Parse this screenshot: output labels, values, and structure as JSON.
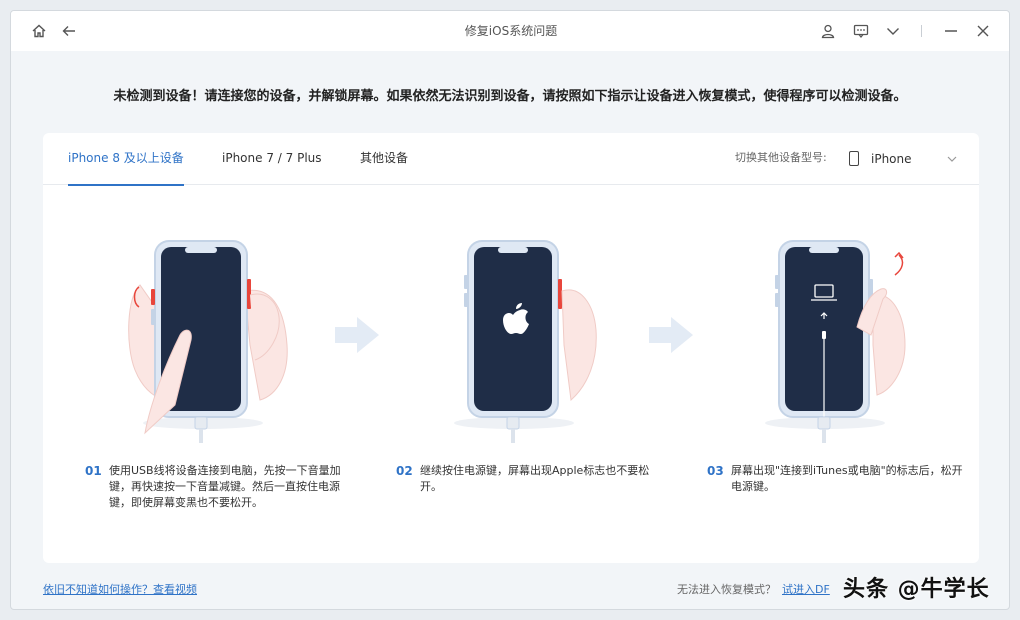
{
  "window": {
    "title": "修复iOS系统问题"
  },
  "notice": "未检测到设备！请连接您的设备，并解锁屏幕。如果依然无法识别到设备，请按照如下指示让设备进入恢复模式，使得程序可以检测设备。",
  "tabs": [
    {
      "label": "iPhone 8 及以上设备",
      "active": true
    },
    {
      "label": "iPhone 7 / 7 Plus",
      "active": false
    },
    {
      "label": "其他设备",
      "active": false
    }
  ],
  "device_switch": {
    "label": "切换其他设备型号:",
    "selected": "iPhone"
  },
  "steps": [
    {
      "num": "01",
      "desc": "使用USB线将设备连接到电脑，先按一下音量加键，再快速按一下音量减键。然后一直按住电源键，即使屏幕变黑也不要松开。"
    },
    {
      "num": "02",
      "desc": "继续按住电源键，屏幕出现Apple标志也不要松开。"
    },
    {
      "num": "03",
      "desc": "屏幕出现\"连接到iTunes或电脑\"的标志后，松开电源键。"
    }
  ],
  "footer": {
    "help_link": "依旧不知道如何操作？查看视频",
    "dfu_question": "无法进入恢复模式？",
    "dfu_link": "试进入DF"
  },
  "watermark": "头条 @牛学长",
  "colors": {
    "accent": "#2f73c7",
    "phone_screen": "#1f2d47",
    "button_red": "#e8463c"
  }
}
